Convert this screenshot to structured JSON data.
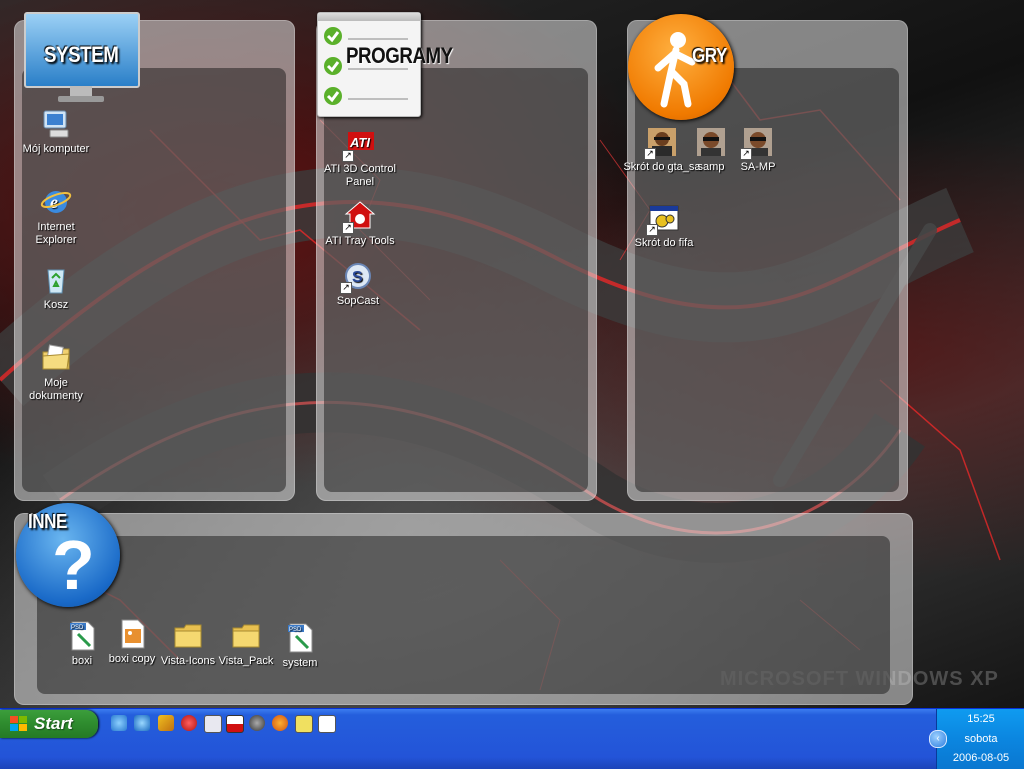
{
  "panels": {
    "system": {
      "title": "SYSTEM"
    },
    "programy": {
      "title": "PROGRAMY"
    },
    "gry": {
      "title": "GRY"
    },
    "inne": {
      "title": "INNE"
    }
  },
  "system_icons": [
    {
      "label": "Mój komputer",
      "icon": "my-computer-icon"
    },
    {
      "label": "Internet Explorer",
      "icon": "internet-explorer-icon"
    },
    {
      "label": "Kosz",
      "icon": "recycle-bin-icon"
    },
    {
      "label": "Moje dokumenty",
      "icon": "my-documents-icon"
    }
  ],
  "programy_icons": [
    {
      "label": "ATI 3D Control Panel",
      "icon": "ati-icon"
    },
    {
      "label": "ATI Tray Tools",
      "icon": "ati-tray-icon"
    },
    {
      "label": "SopCast",
      "icon": "sopcast-icon"
    }
  ],
  "gry_icons": [
    {
      "label": "Skrót do gta_sa",
      "icon": "gta-sa-icon"
    },
    {
      "label": "samp",
      "icon": "samp-icon"
    },
    {
      "label": "SA-MP",
      "icon": "sa-mp-icon"
    },
    {
      "label": "Skrót do fifa",
      "icon": "fifa-icon"
    }
  ],
  "inne_icons": [
    {
      "label": "boxi",
      "icon": "psd-file-icon"
    },
    {
      "label": "boxi copy",
      "icon": "image-file-icon"
    },
    {
      "label": "Vista-Icons",
      "icon": "folder-icon"
    },
    {
      "label": "Vista_Pack",
      "icon": "folder-icon"
    },
    {
      "label": "system",
      "icon": "psd-file-icon"
    }
  ],
  "taskbar": {
    "start_label": "Start",
    "quick_launch": [
      "ie-icon",
      "outlook-icon",
      "winamp-icon",
      "antivirus-icon",
      "headphones-icon",
      "flag-icon",
      "steam-icon",
      "firefox-icon",
      "app-99-icon",
      "tc-icon"
    ]
  },
  "clock": {
    "time": "15:25",
    "day": "sobota",
    "date": "2006-08-05"
  },
  "wallpaper_logo": "MICROSOFT WINDOWS XP"
}
